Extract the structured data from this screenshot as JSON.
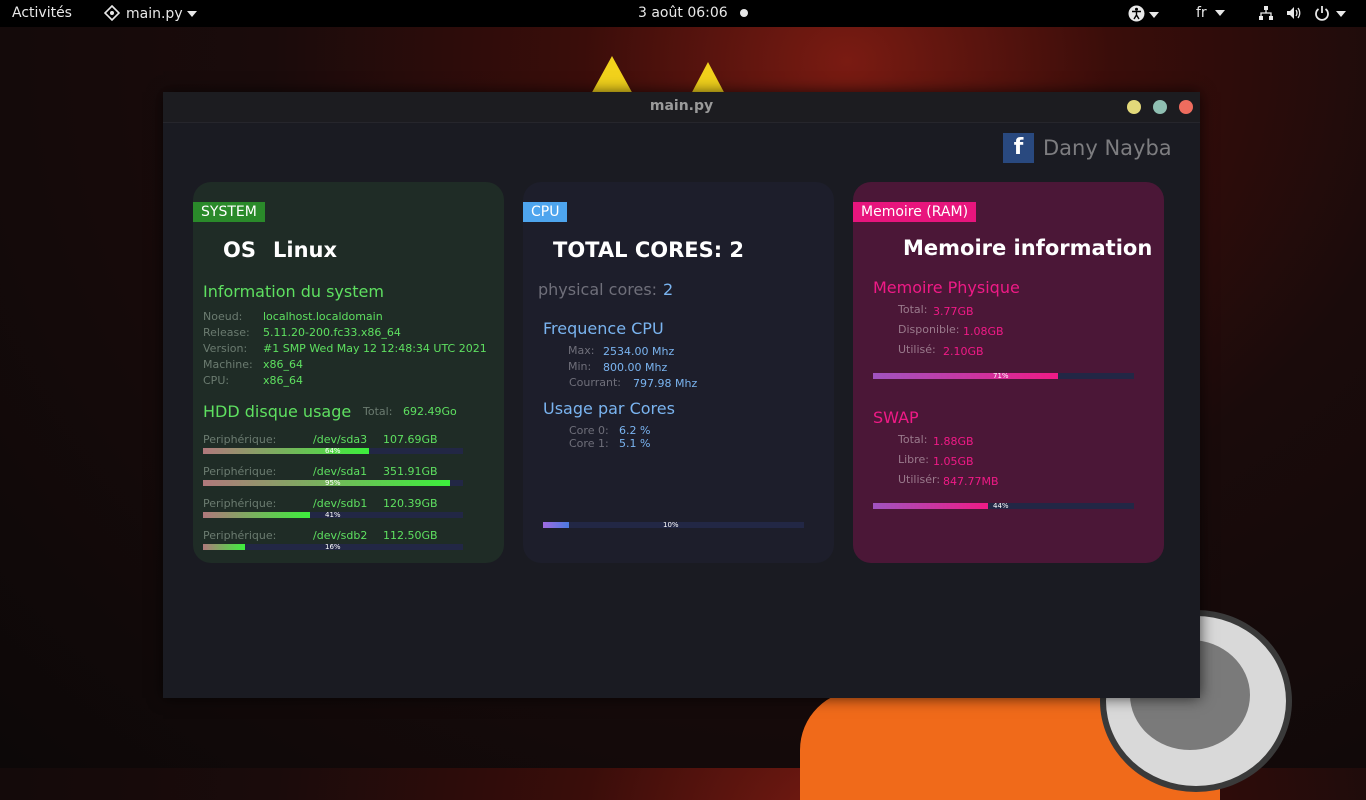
{
  "topbar": {
    "activities": "Activités",
    "app_name": "main.py",
    "clock": "3 août  06:06",
    "language": "fr"
  },
  "window": {
    "title": "main.py"
  },
  "author": {
    "fb_letter": "f",
    "name": "Dany Nayba"
  },
  "system": {
    "tag": "SYSTEM",
    "os_label": "OS",
    "os_value": "Linux",
    "info_title": "Information du system",
    "info": [
      {
        "label": "Noeud:",
        "value": "localhost.localdomain"
      },
      {
        "label": "Release:",
        "value": "5.11.20-200.fc33.x86_64"
      },
      {
        "label": "Version:",
        "value": "#1 SMP Wed May 12 12:48:34 UTC 2021"
      },
      {
        "label": "Machine:",
        "value": "x86_64"
      },
      {
        "label": "CPU:",
        "value": "x86_64"
      }
    ],
    "hdd_title": "HDD disque usage",
    "total_label": "Total:",
    "total_value": "692.49Go",
    "disks": [
      {
        "label": "Periphérique:",
        "device": "/dev/sda3",
        "size": "107.69GB",
        "percent": 64,
        "percent_text": "64%"
      },
      {
        "label": "Periphérique:",
        "device": "/dev/sda1",
        "size": "351.91GB",
        "percent": 95,
        "percent_text": "95%"
      },
      {
        "label": "Periphérique:",
        "device": "/dev/sdb1",
        "size": "120.39GB",
        "percent": 41,
        "percent_text": "41%"
      },
      {
        "label": "Periphérique:",
        "device": "/dev/sdb2",
        "size": "112.50GB",
        "percent": 16,
        "percent_text": "16%"
      }
    ]
  },
  "cpu": {
    "tag": "CPU",
    "total_cores": "TOTAL CORES: 2",
    "physical_label": "physical cores:",
    "physical_value": "2",
    "freq_title": "Frequence CPU",
    "freq": [
      {
        "label": "Max:",
        "value": "2534.00 Mhz"
      },
      {
        "label": "Min:",
        "value": "800.00 Mhz"
      },
      {
        "label": "Courrant:",
        "value": "797.98 Mhz"
      }
    ],
    "usage_title": "Usage par Cores",
    "cores": [
      {
        "label": "Core 0:",
        "value": "6.2 %"
      },
      {
        "label": "Core 1:",
        "value": "5.1 %"
      }
    ],
    "usage_percent": 10,
    "usage_text": "10%"
  },
  "memory": {
    "tag": "Memoire (RAM)",
    "title": "Memoire information",
    "physical_title": "Memoire Physique",
    "physical": [
      {
        "label": "Total:",
        "value": "3.77GB"
      },
      {
        "label": "Disponible:",
        "value": "1.08GB"
      },
      {
        "label": "Utilisé:",
        "value": "2.10GB"
      }
    ],
    "physical_percent": 71,
    "physical_text": "71%",
    "swap_title": "SWAP",
    "swap": [
      {
        "label": "Total:",
        "value": "1.88GB"
      },
      {
        "label": "Libre:",
        "value": "1.05GB"
      },
      {
        "label": "Utilisér:",
        "value": "847.77MB"
      }
    ],
    "swap_percent": 44,
    "swap_text": "44%"
  },
  "colors": {
    "system_card_bg": "#1f2c26",
    "system_tag": "#2a8a2a",
    "system_green": "#5ee060",
    "cpu_card_bg": "#1d1e2b",
    "cpu_tag": "#4ea5ee",
    "cpu_blue": "#7ab4f0",
    "mem_card_bg": "#4b1737",
    "mem_tag": "#e8157d",
    "mem_pink": "#ef1a86"
  }
}
